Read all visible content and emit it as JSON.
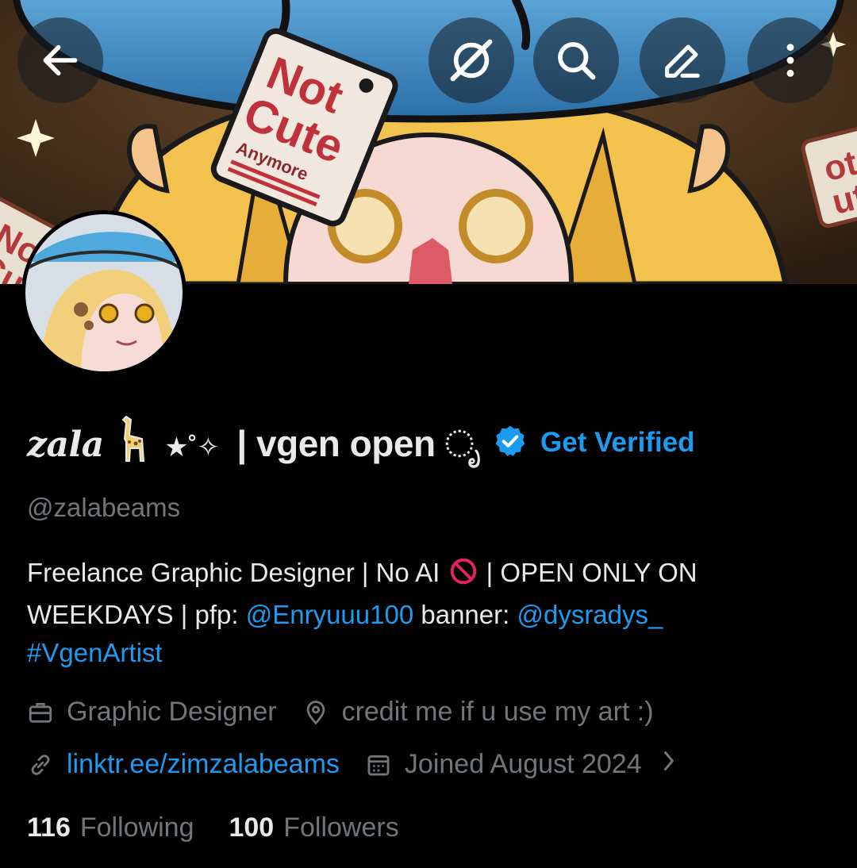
{
  "banner": {
    "tag_lines": [
      "Not",
      "Cute",
      "Anymore"
    ],
    "bg_tag_lines": [
      "Not",
      "Cute"
    ],
    "bg_tag_lines_right": [
      "ot",
      "ute"
    ]
  },
  "toolbar": {
    "back_icon": "arrow-left-icon",
    "grok_icon": "grok-icon",
    "search_icon": "search-icon",
    "edit_icon": "edit-icon",
    "more_icon": "more-vertical-icon"
  },
  "profile": {
    "name_part1": "zala",
    "name_part2": "★˚✧",
    "name_part3": "| vgen open ೃ",
    "get_verified": "Get Verified",
    "handle": "@zalabeams",
    "bio_line1_a": "Freelance Graphic Designer | No AI",
    "bio_line1_b": "| OPEN ONLY ON",
    "bio_line2_a": "WEEKDAYS | pfp:",
    "bio_mention1": "@Enryuuu100",
    "bio_line2_b": "banner:",
    "bio_mention2": "@dysradys_",
    "bio_hashtag": "#VgenArtist",
    "profession": "Graphic Designer",
    "location": "credit me if u use my art :)",
    "website": "linktr.ee/zimzalabeams",
    "joined": "Joined August 2024",
    "following_count": "116",
    "following_label": "Following",
    "followers_count": "100",
    "followers_label": "Followers"
  },
  "colors": {
    "accent": "#1d9bf0",
    "muted": "#71767b",
    "text": "#e7e9ea",
    "background": "#000000"
  }
}
